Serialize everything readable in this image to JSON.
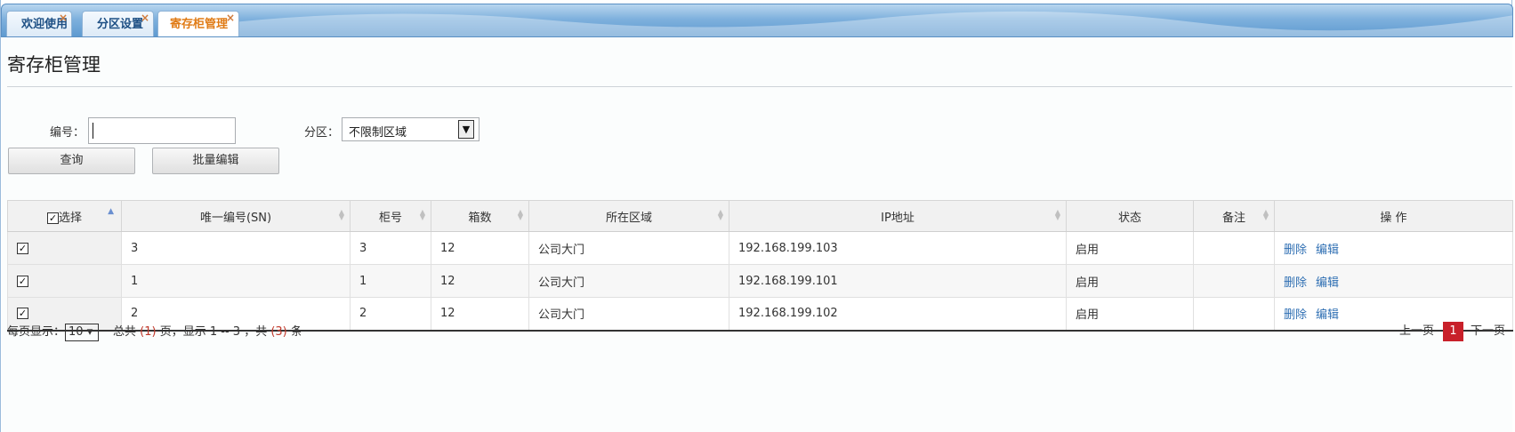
{
  "tabs": [
    {
      "label": "欢迎使用",
      "close": "×"
    },
    {
      "label": "分区设置",
      "close": "×"
    },
    {
      "label": "寄存柜管理",
      "close": "×",
      "active": true
    }
  ],
  "page_title": "寄存柜管理",
  "filters": {
    "sn_label": "编号：",
    "sn_value": "",
    "zone_label": "分区：",
    "zone_selected": "不限制区域"
  },
  "buttons": {
    "query": "查询",
    "batch_edit": "批量编辑"
  },
  "table": {
    "headers": [
      "选择",
      "唯一编号(SN)",
      "柜号",
      "箱数",
      "所在区域",
      "IP地址",
      "状态",
      "备注",
      "操 作"
    ],
    "rows": [
      {
        "sn": "3",
        "cabinet": "3",
        "boxes": "12",
        "zone": "公司大门",
        "ip": "192.168.199.103",
        "status": "启用",
        "note": "",
        "delete": "删除",
        "edit": "编辑"
      },
      {
        "sn": "1",
        "cabinet": "1",
        "boxes": "12",
        "zone": "公司大门",
        "ip": "192.168.199.101",
        "status": "启用",
        "note": "",
        "delete": "删除",
        "edit": "编辑"
      },
      {
        "sn": "2",
        "cabinet": "2",
        "boxes": "12",
        "zone": "公司大门",
        "ip": "192.168.199.102",
        "status": "启用",
        "note": "",
        "delete": "删除",
        "edit": "编辑"
      }
    ]
  },
  "footer": {
    "per_page_label": "每页显示：",
    "per_page": "10",
    "total_pages_pre": "总共",
    "total_pages": "(1)",
    "total_pages_post": "页，显示 1 -- 3 ，共",
    "total_rows": "(3)",
    "total_rows_post": "条"
  },
  "pager": {
    "prev": "上一页",
    "current": "1",
    "next": "下一页"
  },
  "colors": {
    "accent_tab": "#e07b15",
    "link": "#2f6fb3",
    "pager_current": "#c8202a",
    "highlight": "#c0392b"
  }
}
